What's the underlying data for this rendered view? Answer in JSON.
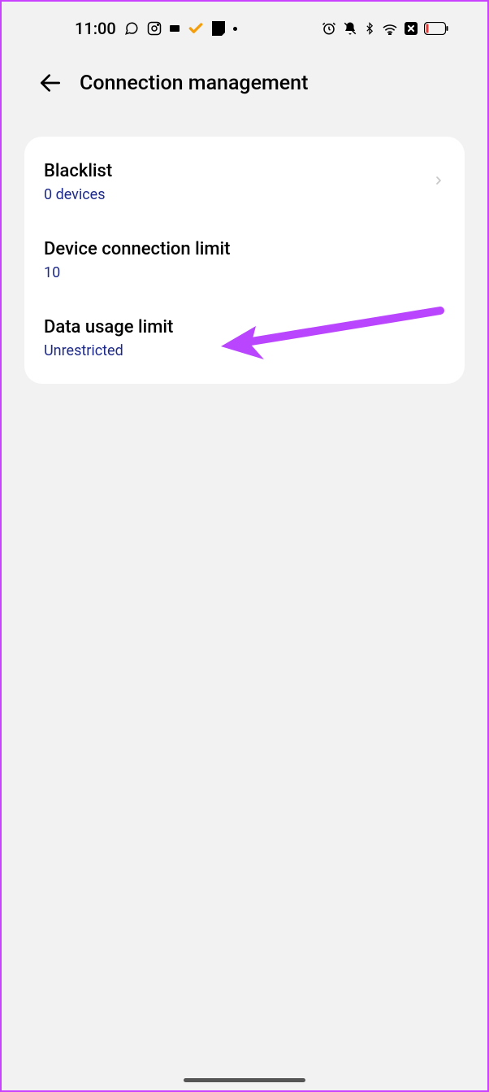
{
  "status": {
    "time": "11:00"
  },
  "header": {
    "title": "Connection management"
  },
  "settings": {
    "blacklist": {
      "title": "Blacklist",
      "value": "0 devices"
    },
    "device_limit": {
      "title": "Device connection limit",
      "value": "10"
    },
    "data_limit": {
      "title": "Data usage limit",
      "value": "Unrestricted"
    }
  }
}
